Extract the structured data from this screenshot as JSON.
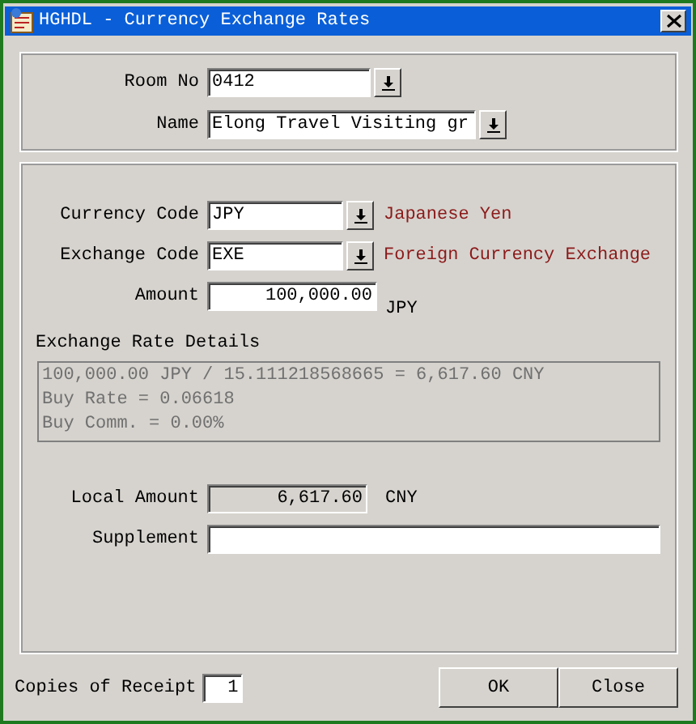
{
  "window": {
    "title": "HGHDL - Currency Exchange Rates"
  },
  "room": {
    "label": "Room No",
    "value": "0412"
  },
  "name": {
    "label": "Name",
    "value": "Elong Travel Visiting gr"
  },
  "currency": {
    "label": "Currency Code",
    "value": "JPY",
    "description": "Japanese Yen"
  },
  "exchange": {
    "label": "Exchange Code",
    "value": "EXE",
    "description": "Foreign Currency Exchange"
  },
  "amount": {
    "label": "Amount",
    "value": "100,000.00",
    "unit": "JPY"
  },
  "details": {
    "title": "Exchange Rate Details",
    "lines": [
      "100,000.00 JPY / 15.111218568665 = 6,617.60 CNY",
      "Buy Rate = 0.06618",
      "Buy Comm. = 0.00%"
    ]
  },
  "local_amount": {
    "label": "Local Amount",
    "value": "6,617.60",
    "unit": "CNY",
    "disabled": true
  },
  "supplement": {
    "label": "Supplement"
  },
  "copies": {
    "label": "Copies of Receipt",
    "value": "1"
  },
  "buttons": [
    "OK",
    "Close"
  ]
}
